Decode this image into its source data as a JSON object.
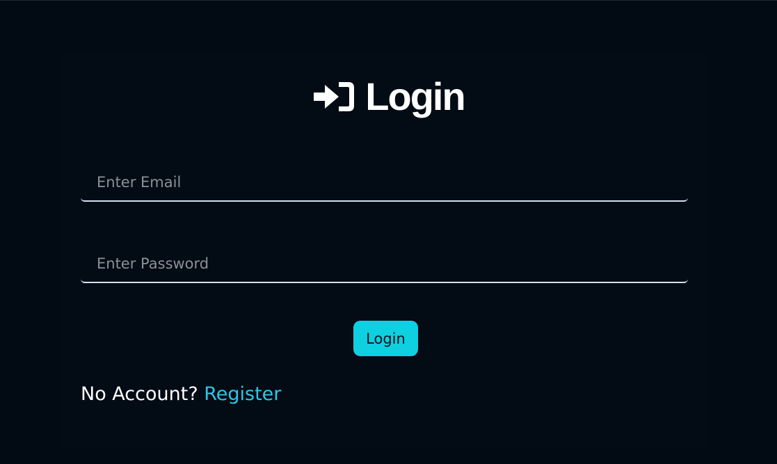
{
  "login_form": {
    "title": "Login",
    "title_icon": "sign-in-icon",
    "email": {
      "value": "",
      "placeholder": "Enter Email"
    },
    "password": {
      "value": "",
      "placeholder": "Enter Password"
    },
    "submit_label": "Login",
    "footer": {
      "prompt": "No Account?",
      "link_label": "Register"
    }
  },
  "colors": {
    "background": "#020a14",
    "accent": "#0fd0e0",
    "link": "#2ec6e6",
    "input_underline": "#cde4f5",
    "placeholder": "#8c9196"
  }
}
